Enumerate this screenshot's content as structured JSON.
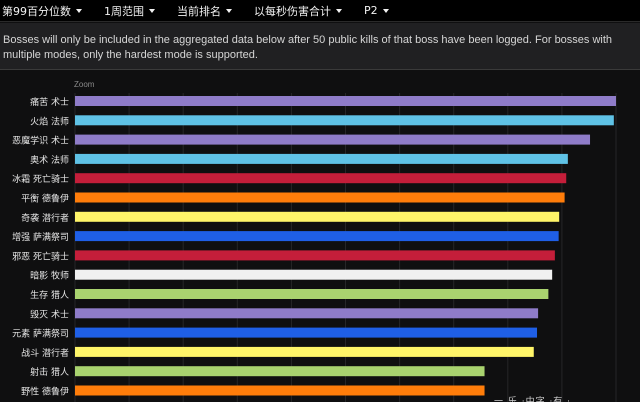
{
  "menu": {
    "items": [
      {
        "label": "第99百分位数"
      },
      {
        "label": "1周范围"
      },
      {
        "label": "当前排名"
      },
      {
        "label": "以每秒伤害合计"
      },
      {
        "label": "P2"
      }
    ]
  },
  "notice": {
    "text": "Bosses will only be included in the aggregated data below after 50 public kills of that boss have been logged. For bosses with multiple modes, only the hardest mode is supported."
  },
  "zoom_label": "Zoom",
  "watermark": "一 乐 ·中字 ·有 ·",
  "colors": {
    "warlock": "#8f7cc9",
    "mage": "#5fc2e6",
    "death_knight": "#c41e3a",
    "druid": "#ff7d0a",
    "rogue": "#fff569",
    "shaman": "#1f5fe6",
    "priest": "#f0f0f0",
    "hunter": "#a9d36f"
  },
  "chart_data": {
    "type": "bar",
    "orientation": "horizontal",
    "categories": [
      "痛苦 术士",
      "火焰 法师",
      "恶魔学识 术士",
      "奥术 法师",
      "冰霜 死亡骑士",
      "平衡 德鲁伊",
      "奇袭 潜行者",
      "增强 萨满祭司",
      "邪恶 死亡骑士",
      "暗影 牧师",
      "生存 猎人",
      "毁灭 术士",
      "元素 萨满祭司",
      "战斗 潜行者",
      "射击 猎人",
      "野性 德鲁伊"
    ],
    "values": [
      100,
      99.6,
      95.2,
      91.1,
      90.8,
      90.5,
      89.5,
      89.4,
      88.7,
      88.2,
      87.5,
      85.6,
      85.4,
      84.8,
      75.7,
      75.7
    ],
    "bar_colors": [
      "#8f7cc9",
      "#5fc2e6",
      "#8f7cc9",
      "#5fc2e6",
      "#c41e3a",
      "#ff7d0a",
      "#fff569",
      "#1f5fe6",
      "#c41e3a",
      "#f0f0f0",
      "#a9d36f",
      "#8f7cc9",
      "#1f5fe6",
      "#fff569",
      "#a9d36f",
      "#ff7d0a"
    ],
    "xlim": [
      0,
      100
    ],
    "grid": true
  }
}
